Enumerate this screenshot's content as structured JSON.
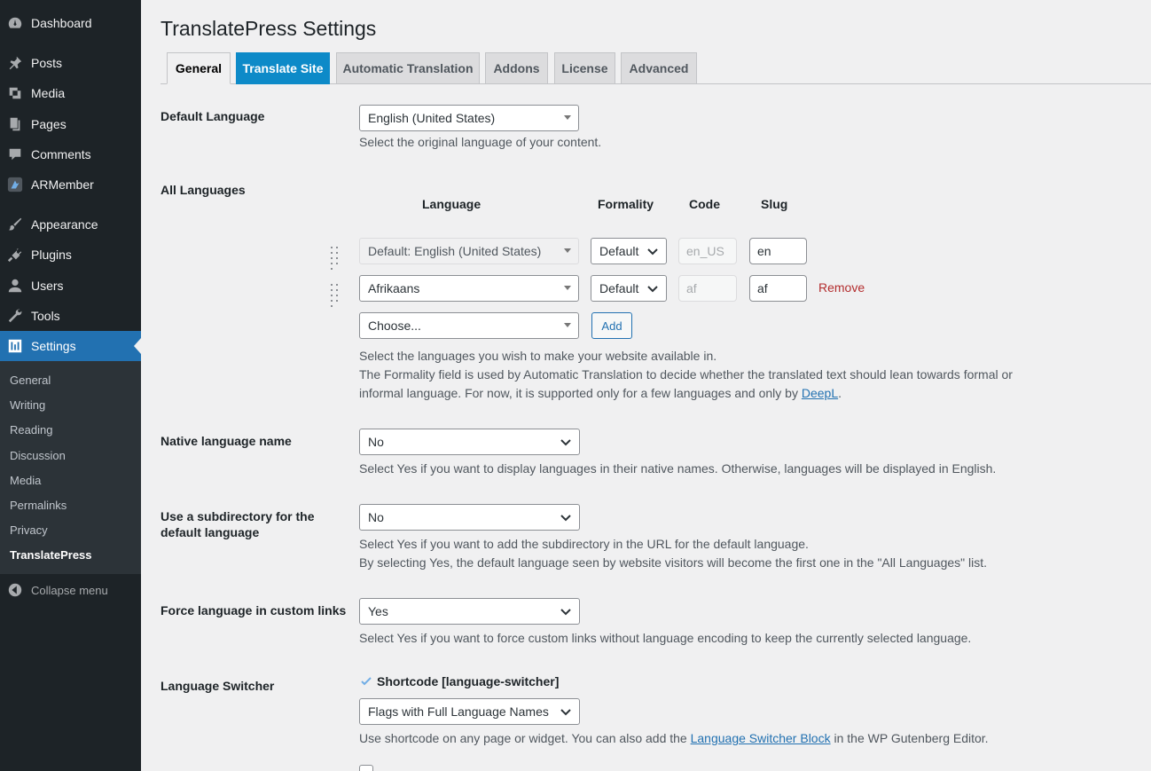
{
  "sidebar": {
    "items": [
      {
        "label": "Dashboard",
        "icon": "dashboard-icon"
      },
      {
        "label": "Posts",
        "icon": "pin-icon"
      },
      {
        "label": "Media",
        "icon": "media-icon"
      },
      {
        "label": "Pages",
        "icon": "pages-icon"
      },
      {
        "label": "Comments",
        "icon": "comment-icon"
      },
      {
        "label": "ARMember",
        "icon": "armember-icon"
      },
      {
        "label": "Appearance",
        "icon": "brush-icon"
      },
      {
        "label": "Plugins",
        "icon": "plugin-icon"
      },
      {
        "label": "Users",
        "icon": "user-icon"
      },
      {
        "label": "Tools",
        "icon": "wrench-icon"
      },
      {
        "label": "Settings",
        "icon": "settings-icon"
      }
    ],
    "submenu": [
      "General",
      "Writing",
      "Reading",
      "Discussion",
      "Media",
      "Permalinks",
      "Privacy",
      "TranslatePress"
    ],
    "collapse_label": "Collapse menu"
  },
  "page": {
    "title": "TranslatePress Settings",
    "tabs": [
      "General",
      "Translate Site",
      "Automatic Translation",
      "Addons",
      "License",
      "Advanced"
    ]
  },
  "default_language": {
    "label": "Default Language",
    "value": "English (United States)",
    "description": "Select the original language of your content."
  },
  "all_languages": {
    "label": "All Languages",
    "headers": {
      "language": "Language",
      "formality": "Formality",
      "code": "Code",
      "slug": "Slug"
    },
    "rows": [
      {
        "language": "Default: English (United States)",
        "formality": "Default",
        "code": "en_US",
        "slug": "en"
      },
      {
        "language": "Afrikaans",
        "formality": "Default",
        "code": "af",
        "slug": "af",
        "remove": "Remove"
      }
    ],
    "choose_placeholder": "Choose...",
    "add_label": "Add",
    "desc_line1": "Select the languages you wish to make your website available in.",
    "desc_line2": "The Formality field is used by Automatic Translation to decide whether the translated text should lean towards formal or",
    "desc_line3_prefix": "informal language. For now, it is supported only for a few languages and only by ",
    "desc_link": "DeepL",
    "desc_line3_suffix": "."
  },
  "native_name": {
    "label": "Native language name",
    "value": "No",
    "description": "Select Yes if you want to display languages in their native names. Otherwise, languages will be displayed in English."
  },
  "subdirectory": {
    "label_line1": "Use a subdirectory for the",
    "label_line2": "default language",
    "value": "No",
    "desc_line1": "Select Yes if you want to add the subdirectory in the URL for the default language.",
    "desc_line2": "By selecting Yes, the default language seen by website visitors will become the first one in the \"All Languages\" list."
  },
  "force_language": {
    "label": "Force language in custom links",
    "value": "Yes",
    "description": "Select Yes if you want to force custom links without language encoding to keep the currently selected language."
  },
  "language_switcher": {
    "label": "Language Switcher",
    "shortcode_label": "Shortcode [language-switcher]",
    "value": "Flags with Full Language Names",
    "desc_prefix": "Use shortcode on any page or widget. You can also add the ",
    "desc_link": "Language Switcher Block",
    "desc_suffix": " in the WP Gutenberg Editor."
  },
  "colors": {
    "sidebar_bg": "#1d2327",
    "accent": "#2271b1",
    "highlight_tab": "#0d8ac8",
    "remove": "#b32d2e"
  }
}
